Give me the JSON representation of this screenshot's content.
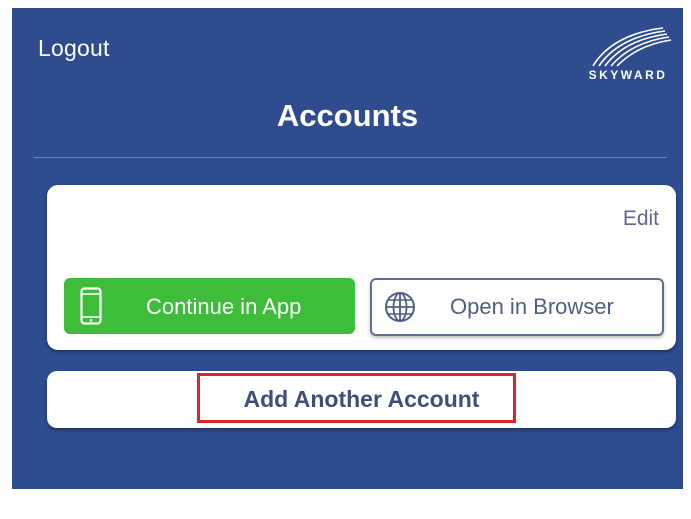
{
  "header": {
    "logout_label": "Logout",
    "title": "Accounts",
    "logo_text": "SKYWARD"
  },
  "account_card": {
    "edit_label": "Edit",
    "continue_label": "Continue in App",
    "continue_icon": "phone-icon",
    "browser_label": "Open in Browser",
    "browser_icon": "globe-icon"
  },
  "add_account": {
    "label": "Add Another Account"
  },
  "colors": {
    "background": "#2e4c8e",
    "continue_button": "#3ebd3b",
    "highlight": "#d9262a"
  }
}
